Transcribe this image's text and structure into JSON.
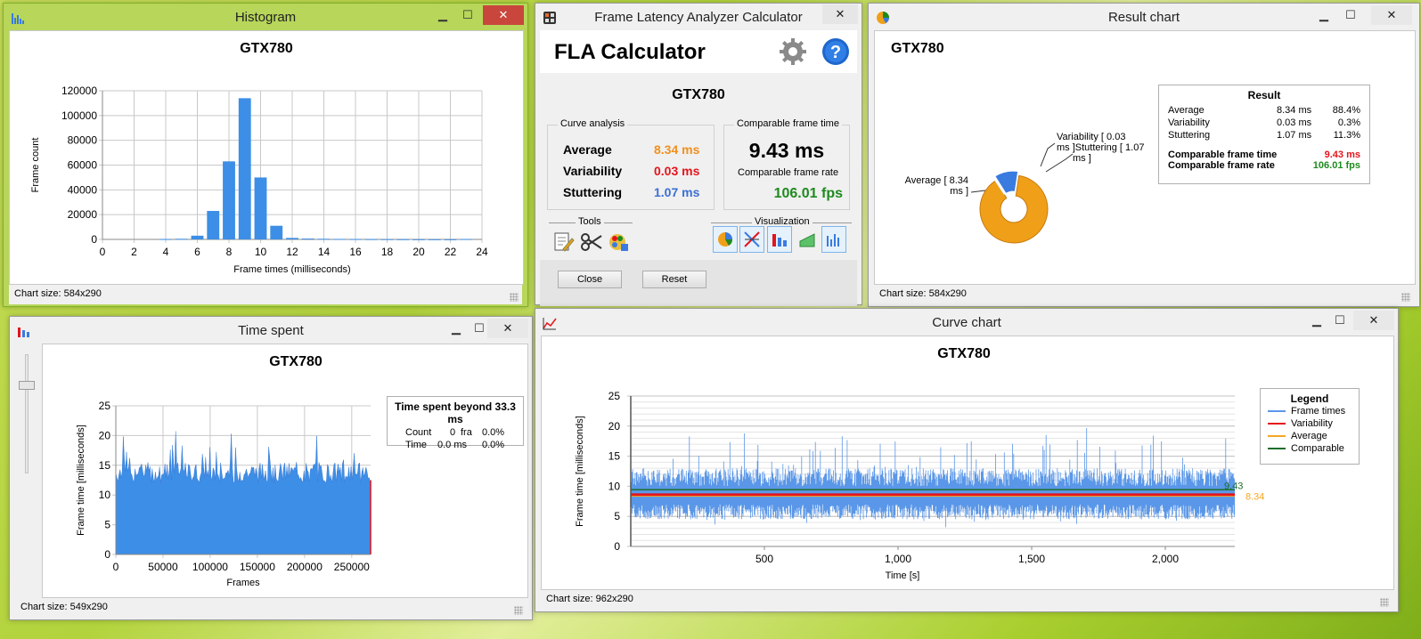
{
  "histogram": {
    "window_title": "Histogram",
    "chart_title": "GTX780",
    "status": "Chart size:  584x290",
    "chart_data": {
      "type": "bar",
      "title": "GTX780",
      "xlabel": "Frame times (milliseconds)",
      "ylabel": "Frame count",
      "x_ticks": [
        "0",
        "2",
        "4",
        "6",
        "8",
        "10",
        "12",
        "14",
        "16",
        "18",
        "20",
        "22",
        "24"
      ],
      "y_ticks": [
        "0",
        "20000",
        "40000",
        "60000",
        "80000",
        "100000",
        "120000"
      ],
      "xlim": [
        0,
        24
      ],
      "ylim": [
        0,
        120000
      ],
      "bar_centers": [
        4,
        5,
        6,
        7,
        8,
        9,
        10,
        11,
        12,
        13,
        14,
        15,
        16,
        17,
        18,
        19,
        20,
        21,
        22,
        23
      ],
      "values": [
        300,
        500,
        3000,
        23000,
        63000,
        114000,
        50000,
        11000,
        1200,
        700,
        500,
        400,
        300,
        250,
        200,
        150,
        120,
        100,
        80,
        300
      ],
      "grid": true,
      "color": "#3d8ee6"
    }
  },
  "calculator": {
    "window_title": "Frame Latency Analyzer Calculator",
    "app_name": "FLA Calculator",
    "gpu": "GTX780",
    "curve_analysis_label": "Curve analysis",
    "average_label": "Average",
    "average_value": "8.34 ms",
    "variability_label": "Variability",
    "variability_value": "0.03 ms",
    "stuttering_label": "Stuttering",
    "stuttering_value": "1.07 ms",
    "comparable_time_label": "Comparable frame time",
    "comparable_time_value": "9.43 ms",
    "comparable_rate_label": "Comparable frame rate",
    "comparable_rate_value": "106.01 fps",
    "tools_label": "Tools",
    "visualization_label": "Visualization",
    "close_label": "Close",
    "reset_label": "Reset",
    "colors": {
      "average": "#f0901e",
      "variability": "#e4141b",
      "stuttering": "#3a6fd4",
      "fps": "#1e8a1e"
    }
  },
  "result_chart": {
    "window_title": "Result chart",
    "chart_title": "GTX780",
    "status": "Chart size:  584x290",
    "result_title": "Result",
    "rows": [
      {
        "label": "Average",
        "ms": "8.34 ms",
        "pct": "88.4%"
      },
      {
        "label": "Variability",
        "ms": "0.03 ms",
        "pct": "0.3%"
      },
      {
        "label": "Stuttering",
        "ms": "1.07 ms",
        "pct": "11.3%"
      }
    ],
    "comparable_time_label": "Comparable frame time",
    "comparable_time_value": "9.43 ms",
    "comparable_rate_label": "Comparable frame rate",
    "comparable_rate_value": "106.01 fps",
    "chart_data": {
      "type": "pie",
      "title": "GTX780",
      "slices": [
        {
          "label": "Average [ 8.34 ms ]",
          "value": 88.4,
          "color": "#f0a018"
        },
        {
          "label": "Variability [ 0.03 ms ]",
          "value": 0.3,
          "color": "#e4141b"
        },
        {
          "label": "Stuttering [ 1.07 ms ]",
          "value": 11.3,
          "color": "#3a7be0"
        }
      ]
    }
  },
  "time_spent": {
    "window_title": "Time spent",
    "chart_title": "GTX780",
    "status": "Chart size:  549x290",
    "beyond_title": "Time spent beyond 33.3 ms",
    "count_label": "Count",
    "count_value": "0",
    "count_unit": "fra",
    "count_pct": "0.0%",
    "time_label": "Time",
    "time_value": "0.0 ms",
    "time_pct": "0.0%",
    "chart_data": {
      "type": "area",
      "title": "GTX780",
      "xlabel": "Frames",
      "ylabel": "Frame time [milliseconds]",
      "x_ticks": [
        "0",
        "50000",
        "100000",
        "150000",
        "200000",
        "250000"
      ],
      "y_ticks": [
        "0",
        "5",
        "10",
        "15",
        "20",
        "25"
      ],
      "xlim": [
        0,
        270000
      ],
      "ylim": [
        0,
        25
      ],
      "base_value": 12,
      "spike_max": 22,
      "color": "#3d8ee6"
    }
  },
  "curve_chart": {
    "window_title": "Curve chart",
    "chart_title": "GTX780",
    "status": "Chart size:  962x290",
    "legend_title": "Legend",
    "legend": [
      {
        "name": "Frame times",
        "color": "#5a97e8"
      },
      {
        "name": "Variability",
        "color": "#e4141b"
      },
      {
        "name": "Average",
        "color": "#f5a623"
      },
      {
        "name": "Comparable",
        "color": "#1b6e2b"
      }
    ],
    "label_comparable": "9.43",
    "label_average": "8.34",
    "chart_data": {
      "type": "line",
      "title": "GTX780",
      "xlabel": "Time [s]",
      "ylabel": "Frame time [milliseconds]",
      "x_ticks": [
        "500",
        "1,000",
        "1,500",
        "2,000"
      ],
      "y_ticks": [
        "0",
        "5",
        "10",
        "15",
        "20",
        "25"
      ],
      "xlim": [
        0,
        2260
      ],
      "ylim": [
        0,
        25
      ],
      "series": [
        {
          "name": "Frame times",
          "mean": 8.34,
          "color": "#5a97e8"
        },
        {
          "name": "Variability",
          "value": 8.6,
          "color": "#e4141b"
        },
        {
          "name": "Average",
          "value": 8.34,
          "color": "#f5a623"
        },
        {
          "name": "Comparable",
          "value": 9.43,
          "color": "#1b6e2b"
        }
      ]
    }
  }
}
